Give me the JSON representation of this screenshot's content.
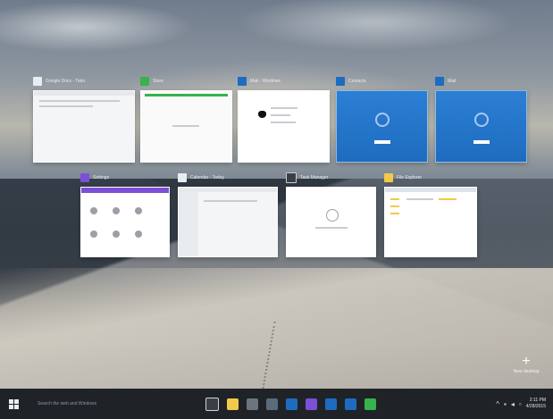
{
  "colors": {
    "taskbar": "#1f2328",
    "store_green": "#37b24d",
    "win_blue": "#1e6cc0",
    "purple": "#7b4fd6",
    "folder_yellow": "#f2c94c"
  },
  "taskview": {
    "row1": [
      {
        "title": "Google Docs - Todo",
        "icon": "gear-icon",
        "icon_color": "#e8edf2"
      },
      {
        "title": "Store",
        "icon": "store-icon",
        "icon_color": "#37b24d"
      },
      {
        "title": "Mail - Windows",
        "icon": "mail-icon",
        "icon_color": "#1e6cc0"
      },
      {
        "title": "Contacts",
        "icon": "window-icon",
        "icon_color": "#1e6cc0"
      },
      {
        "title": "Mail",
        "icon": "play-icon",
        "icon_color": "#1e6cc0"
      }
    ],
    "row2": [
      {
        "title": "Settings",
        "icon": "settings-icon",
        "icon_color": "#7b4fd6"
      },
      {
        "title": "Calendar - Today",
        "icon": "gear-icon",
        "icon_color": "#e8edf2"
      },
      {
        "title": "Task Manager",
        "icon": "window-icon",
        "icon_color": "#3a3f45"
      },
      {
        "title": "File Explorer",
        "icon": "folder-icon",
        "icon_color": "#f2c94c"
      }
    ]
  },
  "new_desktop": {
    "label": "New desktop"
  },
  "taskbar": {
    "search_placeholder": "Search the web and Windows",
    "pinned": [
      {
        "name": "task-view",
        "color": "#3a3f45"
      },
      {
        "name": "file-explorer",
        "color": "#f2c94c"
      },
      {
        "name": "store",
        "color": "#6c757d"
      },
      {
        "name": "edge",
        "color": "#5b6b7a"
      },
      {
        "name": "mail",
        "color": "#1e6cc0"
      },
      {
        "name": "settings",
        "color": "#7b4fd6"
      },
      {
        "name": "photos",
        "color": "#1e6cc0"
      },
      {
        "name": "contacts",
        "color": "#1e6cc0"
      },
      {
        "name": "xbox",
        "color": "#37b24d"
      }
    ],
    "clock_time": "2:11 PM",
    "clock_date": "4/28/2015"
  }
}
